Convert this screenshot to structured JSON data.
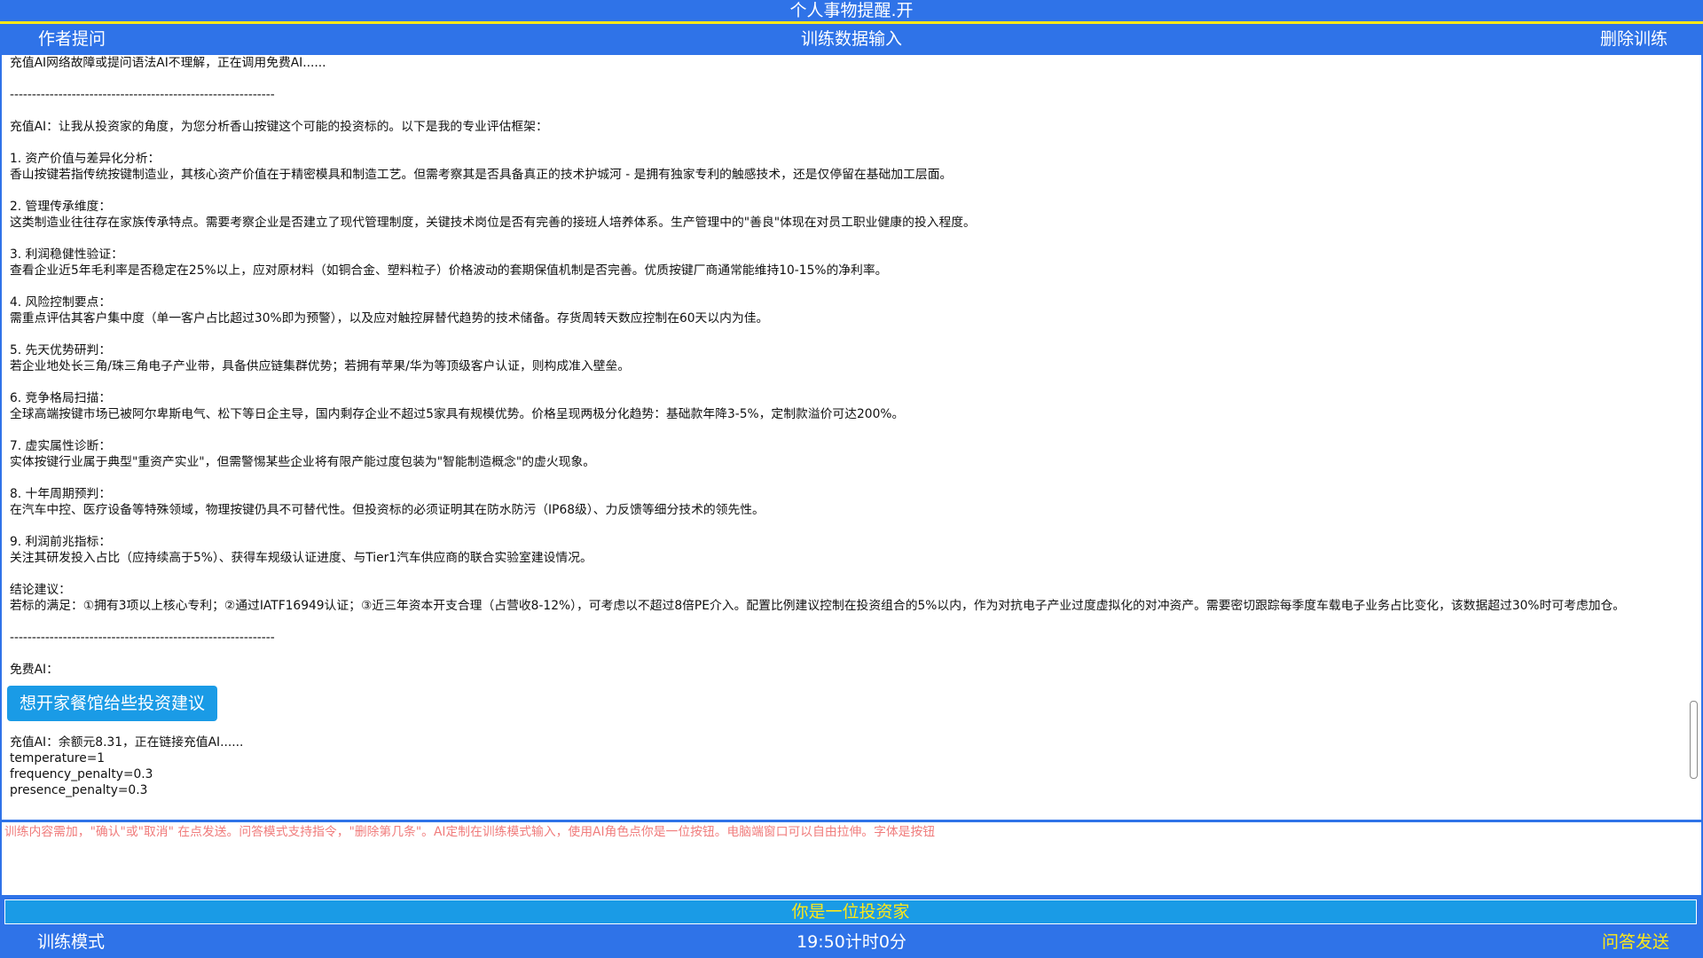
{
  "title": "个人事物提醒.开",
  "top_nav": {
    "left": "作者提问",
    "center": "训练数据输入",
    "right": "删除训练"
  },
  "chat": {
    "lines_before": [
      "充值AI网络故障或提问语法AI不理解，正在调用免费AI......",
      "",
      "------------------------------------------------------------",
      "",
      "充值AI：让我从投资家的角度，为您分析香山按键这个可能的投资标的。以下是我的专业评估框架：",
      "",
      "1. 资产价值与差异化分析：",
      "香山按键若指传统按键制造业，其核心资产价值在于精密模具和制造工艺。但需考察其是否具备真正的技术护城河 - 是拥有独家专利的触感技术，还是仅停留在基础加工层面。",
      "",
      "2. 管理传承维度：",
      "这类制造业往往存在家族传承特点。需要考察企业是否建立了现代管理制度，关键技术岗位是否有完善的接班人培养体系。生产管理中的\"善良\"体现在对员工职业健康的投入程度。",
      "",
      "3. 利润稳健性验证：",
      "查看企业近5年毛利率是否稳定在25%以上，应对原材料（如铜合金、塑料粒子）价格波动的套期保值机制是否完善。优质按键厂商通常能维持10-15%的净利率。",
      "",
      "4. 风险控制要点：",
      "需重点评估其客户集中度（单一客户占比超过30%即为预警），以及应对触控屏替代趋势的技术储备。存货周转天数应控制在60天以内为佳。",
      "",
      "5. 先天优势研判：",
      "若企业地处长三角/珠三角电子产业带，具备供应链集群优势；若拥有苹果/华为等顶级客户认证，则构成准入壁垒。",
      "",
      "6. 竞争格局扫描：",
      "全球高端按键市场已被阿尔卑斯电气、松下等日企主导，国内剩存企业不超过5家具有规模优势。价格呈现两极分化趋势：基础款年降3-5%，定制款溢价可达200%。",
      "",
      "7. 虚实属性诊断：",
      "实体按键行业属于典型\"重资产实业\"，但需警惕某些企业将有限产能过度包装为\"智能制造概念\"的虚火现象。",
      "",
      "8. 十年周期预判：",
      "在汽车中控、医疗设备等特殊领域，物理按键仍具不可替代性。但投资标的必须证明其在防水防污（IP68级）、力反馈等细分技术的领先性。",
      "",
      "9. 利润前兆指标：",
      "关注其研发投入占比（应持续高于5%）、获得车规级认证进度、与Tier1汽车供应商的联合实验室建设情况。",
      "",
      "结论建议：",
      "若标的满足：①拥有3项以上核心专利；②通过IATF16949认证；③近三年资本开支合理（占营收8-12%），可考虑以不超过8倍PE介入。配置比例建议控制在投资组合的5%以内，作为对抗电子产业过度虚拟化的对冲资产。需要密切跟踪每季度车载电子业务占比变化，该数据超过30%时可考虑加仓。",
      "",
      "------------------------------------------------------------",
      "",
      "免费AI："
    ],
    "user_bubble": "想开家餐馆给些投资建议",
    "lines_after": [
      "充值AI：余额元8.31，正在链接充值AI......",
      "temperature=1",
      "frequency_penalty=0.3",
      "presence_penalty=0.3"
    ]
  },
  "input": {
    "placeholder": "训练内容需加，\"确认\"或\"取消\" 在点发送。问答模式支持指令，\"删除第几条\"。AI定制在训练模式输入，使用AI角色点你是一位按钮。电脑端窗口可以自由拉伸。字体是按钮",
    "value": ""
  },
  "role_bar": {
    "label": "你是一位投资家"
  },
  "bottom_bar": {
    "left": "训练模式",
    "center": "19:50计时0分",
    "right": "问答发送"
  },
  "colors": {
    "primary_blue": "#2f73e8",
    "accent_yellow": "#ffe817",
    "bubble_blue": "#1a9be6",
    "placeholder_red": "#f07c7c"
  }
}
